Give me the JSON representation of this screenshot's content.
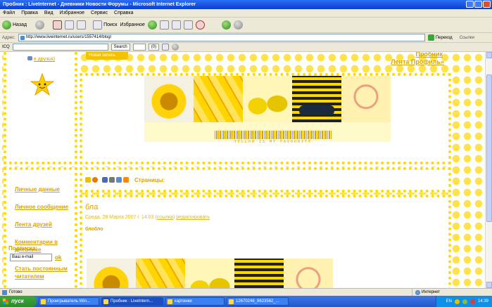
{
  "window": {
    "title": "Пробник : LiveInternet - Дневники Новости Форумы - Microsoft Internet Explorer"
  },
  "menu": [
    "Файл",
    "Правка",
    "Вид",
    "Избранное",
    "Сервис",
    "Справка"
  ],
  "toolbar": {
    "back_label": "Назад",
    "search_label": "Поиск",
    "favorites_label": "Избранное"
  },
  "address": {
    "label": "Адрес:",
    "url": "http://www.liveinternet.ru/users/1557414/blog/",
    "go_label": "Переход",
    "links_label": "Ссылки"
  },
  "icqbar": {
    "label": "ICQ",
    "search_label": "Search",
    "counter": "(0)"
  },
  "page": {
    "friends_link": "в друзья)",
    "new_post_label": "Новая запись",
    "profile_link": "Пробник",
    "feed_profile_link": "Лента Профиль»",
    "nav": [
      "Личные данные",
      "Личное сообщение",
      "Лента друзей",
      "Комментарии в дневнике",
      "Стать постоянным читателем"
    ],
    "subscribe_label": "Подписка:",
    "subscribe_placeholder": "Ваш e-mail",
    "subscribe_ok": "ok",
    "banner_text": "YELLOW IS MY FAVOURITE",
    "pages_label": "Страницы:",
    "post": {
      "title": "бла",
      "meta": "Среда, 28 Марта 2007 г. 14:03",
      "link_label": "ссылка",
      "edit_label": "редактировать",
      "body": "блобло"
    }
  },
  "status": {
    "text": "Готово",
    "zone": "Интернет"
  },
  "taskbar": {
    "start_label": "пуск",
    "tasks": [
      "Проигрыватель Win...",
      "Пробник : LiveIntern...",
      "картинки",
      "12670246_8623562_..."
    ],
    "lang": "EN",
    "clock": "14:39"
  },
  "colors": {
    "accent": "#d9a300",
    "dots": "#ffe24a",
    "xp_blue": "#2457c9"
  }
}
